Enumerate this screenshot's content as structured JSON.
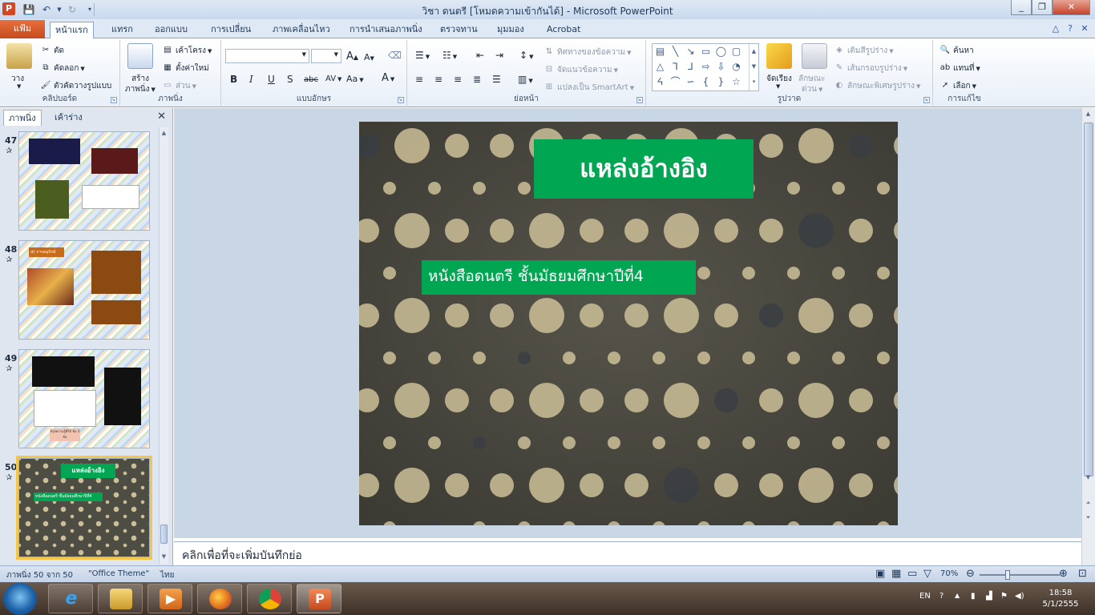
{
  "window": {
    "title": "วิชา ดนตรี [โหมดความเข้ากันได้] - Microsoft PowerPoint",
    "app_icon_letter": "P"
  },
  "tabs": {
    "file": "แฟ้ม",
    "items": [
      "หน้าแรก",
      "แทรก",
      "ออกแบบ",
      "การเปลี่ยน",
      "ภาพเคลื่อนไหว",
      "การนำเสนอภาพนิ่ง",
      "ตรวจทาน",
      "มุมมอง",
      "Acrobat"
    ],
    "active_index": 0
  },
  "ribbon": {
    "clipboard": {
      "label": "คลิปบอร์ด",
      "paste": "วาง",
      "cut": "ตัด",
      "copy": "คัดลอก",
      "format_painter": "ตัวคัดวางรูปแบบ"
    },
    "slides": {
      "label": "ภาพนิ่ง",
      "new_slide": "สร้าง",
      "new_slide_2": "ภาพนิ่ง",
      "layout": "เค้าโครง",
      "reset": "ตั้งค่าใหม่",
      "section": "ส่วน"
    },
    "font": {
      "label": "แบบอักษร",
      "font_name": "",
      "font_size": ""
    },
    "paragraph": {
      "label": "ย่อหน้า",
      "text_direction": "ทิศทางของข้อความ",
      "align_text": "จัดแนวข้อความ",
      "smartart": "แปลงเป็น SmartArt"
    },
    "drawing": {
      "label": "รูปวาด",
      "arrange": "จัดเรียง",
      "quick_styles": "ลักษณะ",
      "quick_styles_2": "ด่วน",
      "shape_fill": "เติมสีรูปร่าง",
      "shape_outline": "เส้นกรอบรูปร่าง",
      "shape_effects": "ลักษณะพิเศษรูปร่าง"
    },
    "editing": {
      "label": "การแก้ไข",
      "find": "ค้นหา",
      "replace": "แทนที่",
      "select": "เลือก"
    }
  },
  "side_panel": {
    "tab_slides": "ภาพนิ่ง",
    "tab_outline": "เค้าร่าง",
    "thumbnails": [
      {
        "number": "47"
      },
      {
        "number": "48",
        "title": "๕) การอนุรักษ์"
      },
      {
        "number": "49",
        "caption": "สรุปความรู้ที่ได้ ข้อ 3 ข้อ"
      },
      {
        "number": "50",
        "title": "แหล่งอ้างอิง",
        "subtitle": "หนังสือดนตรี ชั้นมัธยมศึกษาปีที่4"
      }
    ]
  },
  "slide": {
    "title": "แหล่งอ้างอิง",
    "subtitle": "หนังสือดนตรี ชั้นมัธยมศึกษาปีที่4",
    "accent_color": "#00a651"
  },
  "notes": {
    "placeholder": "คลิกเพื่อที่จะเพิ่มบันทึกย่อ"
  },
  "status": {
    "slide_count": "ภาพนิ่ง 50 จาก 50",
    "theme": "\"Office Theme\"",
    "language": "ไทย",
    "zoom": "70%",
    "zoom_value": 0.7
  },
  "taskbar": {
    "language": "EN",
    "time": "18:58",
    "date": "5/1/2555"
  }
}
